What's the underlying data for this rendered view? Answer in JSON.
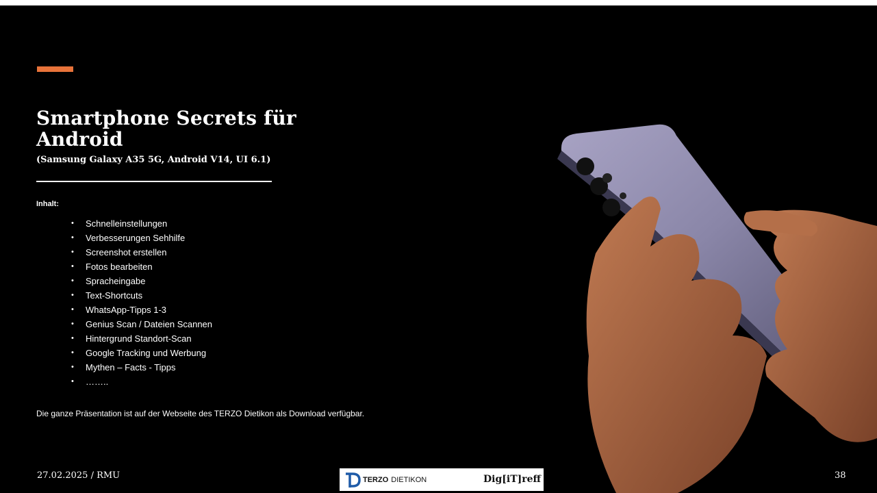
{
  "slide": {
    "title": "Smartphone Secrets für Android",
    "subtitle": "(Samsung Galaxy A35 5G, Android V14, UI 6.1)",
    "content_label": "Inhalt:",
    "bullet_symbol": "•",
    "items": [
      "Schnelleinstellungen",
      "Verbesserungen Sehhilfe",
      "Screenshot erstellen",
      "Fotos bearbeiten",
      "Spracheingabe",
      "Text-Shortcuts",
      "WhatsApp-Tipps 1-3",
      "Genius Scan / Dateien Scannen",
      "Hintergrund Standort-Scan",
      "Google Tracking und Werbung",
      "Mythen – Facts - Tipps",
      "…….."
    ],
    "note": "Die ganze Präsentation ist auf der Webseite des TERZO Dietikon als Download verfügbar."
  },
  "footer": {
    "date_author": "27.02.2025 / RMU",
    "page_number": "38",
    "logo_terzo": "TERZO",
    "logo_dietikon": "DIETIKON",
    "logo_digitreff": "Dig[iT]reff"
  },
  "colors": {
    "background": "#000000",
    "accent": "#E8733A",
    "text": "#FFFFFF",
    "logo_blue": "#1F5BA8",
    "phone_body": "#8A86A8",
    "skin": "#A0603D"
  },
  "icons": {
    "photo": "hands-holding-smartphone-photo",
    "logo": "terzo-d-logo-icon"
  }
}
